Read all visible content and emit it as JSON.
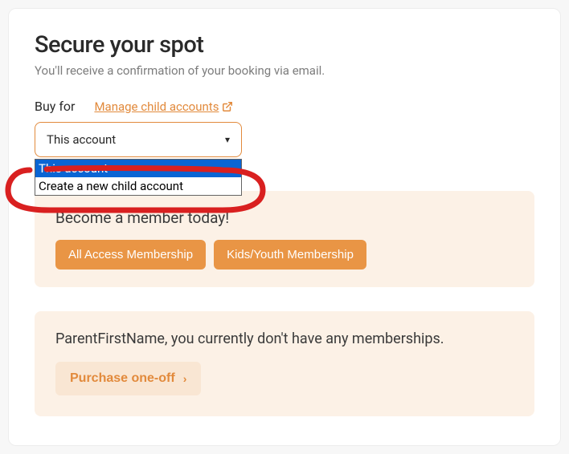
{
  "title": "Secure your spot",
  "subtitle": "You'll receive a confirmation of your booking via email.",
  "buyFor": {
    "label": "Buy for",
    "manageLinkText": "Manage child accounts",
    "selectedValue": "This account",
    "options": [
      "This account",
      "Create a new child account"
    ]
  },
  "memberPanel": {
    "title": "Become a member today!",
    "buttons": [
      "All Access Membership",
      "Kids/Youth Membership"
    ]
  },
  "noMembershipPanel": {
    "text": "ParentFirstName, you currently don't have any memberships.",
    "ctaLabel": "Purchase one-off"
  }
}
